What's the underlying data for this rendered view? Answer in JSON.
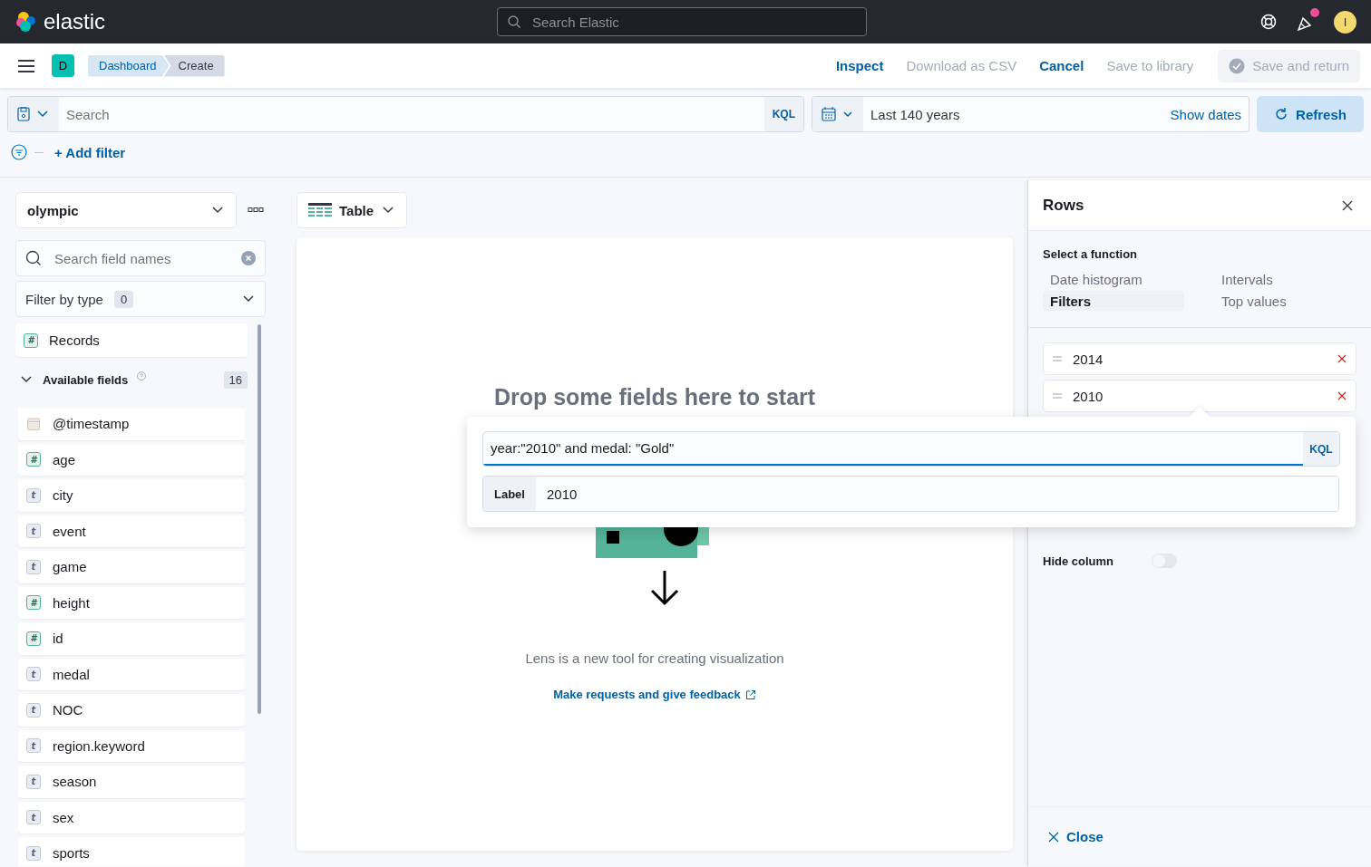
{
  "header": {
    "logo_text": "elastic",
    "search": {
      "placeholder": "Search Elastic"
    },
    "avatar": "I",
    "has_news": true
  },
  "app_bar": {
    "space_badge": "D",
    "breadcrumbs": [
      {
        "label": "Dashboard",
        "selected": false
      },
      {
        "label": "Create",
        "selected": true
      }
    ],
    "actions": [
      {
        "label": "Inspect",
        "disabled": false
      },
      {
        "label": "Download as CSV",
        "disabled": true
      },
      {
        "label": "Cancel",
        "disabled": false
      },
      {
        "label": "Save to library",
        "disabled": true
      }
    ],
    "save_button": {
      "label": "Save and return",
      "disabled": true
    }
  },
  "query_bar": {
    "placeholder": "Search",
    "language": "KQL",
    "time_range": "Last 140 years",
    "show_dates": "Show dates",
    "refresh": "Refresh"
  },
  "filter_bar": {
    "add_filter": "+ Add filter"
  },
  "sidebar": {
    "index_pattern": "olympic",
    "search": {
      "placeholder": "Search field names"
    },
    "filter_type": {
      "label": "Filter by type",
      "count": "0"
    },
    "records": {
      "name": "Records",
      "kind": "number",
      "glyph": "#"
    },
    "available": {
      "label": "Available fields",
      "count": "16",
      "expanded": true
    },
    "fields": [
      {
        "name": "@timestamp",
        "kind": "date"
      },
      {
        "name": "age",
        "kind": "number",
        "glyph": "#"
      },
      {
        "name": "city",
        "kind": "string",
        "glyph": "t"
      },
      {
        "name": "event",
        "kind": "string",
        "glyph": "t"
      },
      {
        "name": "game",
        "kind": "string",
        "glyph": "t"
      },
      {
        "name": "height",
        "kind": "number",
        "glyph": "#"
      },
      {
        "name": "id",
        "kind": "number",
        "glyph": "#"
      },
      {
        "name": "medal",
        "kind": "string",
        "glyph": "t"
      },
      {
        "name": "NOC",
        "kind": "string",
        "glyph": "t"
      },
      {
        "name": "region.keyword",
        "kind": "string",
        "glyph": "t"
      },
      {
        "name": "season",
        "kind": "string",
        "glyph": "t"
      },
      {
        "name": "sex",
        "kind": "string",
        "glyph": "t"
      },
      {
        "name": "sports",
        "kind": "string",
        "glyph": "t"
      }
    ]
  },
  "workspace": {
    "chart_type": "Table",
    "empty_title": "Drop some fields here to start",
    "description": "Lens is a new tool for creating visualization",
    "feedback_link": "Make requests and give feedback"
  },
  "rows_panel": {
    "title": "Rows",
    "function_label": "Select a function",
    "functions": [
      {
        "label": "Date histogram",
        "selected": false
      },
      {
        "label": "Intervals",
        "selected": false
      },
      {
        "label": "Filters",
        "selected": true
      },
      {
        "label": "Top values",
        "selected": false
      }
    ],
    "filters": [
      {
        "label": "2014"
      },
      {
        "label": "2010"
      }
    ],
    "hide_column": {
      "label": "Hide column",
      "on": false
    },
    "close": "Close"
  },
  "filter_popover": {
    "query": "year:\"2010\" and medal: \"Gold\"",
    "language": "KQL",
    "label_prefix": "Label",
    "label_value": "2010"
  }
}
